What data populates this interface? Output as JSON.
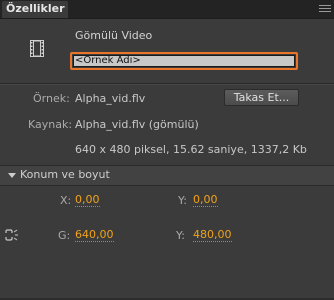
{
  "panel": {
    "tab_label": "Özellikler"
  },
  "symbol": {
    "type_label": "Gömülü Video",
    "icon": "film-strip-icon"
  },
  "instance_name": {
    "value": "<Örnek Adı>",
    "placeholder": "<Örnek Adı>"
  },
  "instance": {
    "label": "Örnek:",
    "value": "Alpha_vid.flv",
    "swap_label": "Takas Et..."
  },
  "source": {
    "label": "Kaynak:",
    "value": "Alpha_vid.flv (gömülü)",
    "details": "640 x 480 piksel, 15.62 saniye, 1337,2 Kb"
  },
  "position_size": {
    "title": "Konum ve boyut",
    "x_label": "X:",
    "x_value": "0,00",
    "y_label": "Y:",
    "y_value": "0,00",
    "w_label": "G:",
    "w_value": "640,00",
    "h_label": "Y:",
    "h_value": "480,00",
    "link_icon": "chain-link-icon"
  },
  "colors": {
    "accent_orange": "#e8752a",
    "hot_value": "#f0a21a",
    "panel_bg": "#3b3b3b"
  }
}
